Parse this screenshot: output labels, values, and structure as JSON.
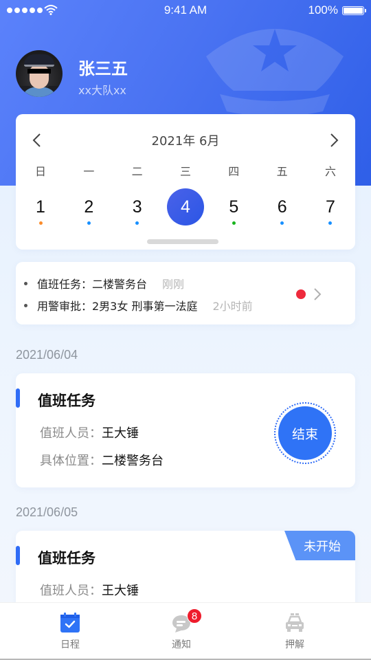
{
  "status_bar": {
    "time": "9:41 AM",
    "battery": "100%",
    "signal_icon": "signal-dots-icon",
    "wifi_icon": "wifi-icon",
    "battery_icon": "battery-icon"
  },
  "profile": {
    "name": "张三五",
    "unit": "xx大队xx",
    "avatar_icon": "police-avatar",
    "background_icon": "police-cap-icon"
  },
  "calendar": {
    "title": "2021年 6月",
    "weekdays": [
      "日",
      "一",
      "二",
      "三",
      "四",
      "五",
      "六"
    ],
    "days": [
      {
        "num": "1",
        "dot_color": "#fb8c2c",
        "active": false
      },
      {
        "num": "2",
        "dot_color": "#1890ff",
        "active": false
      },
      {
        "num": "3",
        "dot_color": "#1890ff",
        "active": false
      },
      {
        "num": "4",
        "dot_color": null,
        "active": true
      },
      {
        "num": "5",
        "dot_color": "#19b41e",
        "active": false
      },
      {
        "num": "6",
        "dot_color": "#1890ff",
        "active": false
      },
      {
        "num": "7",
        "dot_color": "#1890ff",
        "active": false
      }
    ]
  },
  "notices": [
    {
      "text": "值班任务：二楼警务台",
      "time": "刚刚"
    },
    {
      "text": "用警审批：2男3女 刑事第一法庭",
      "time": "2小时前"
    }
  ],
  "notice_unread_color": "#ee2a3c",
  "tasks": [
    {
      "date": "2021/06/04",
      "title": "值班任务",
      "rows": [
        {
          "label": "值班人员：",
          "value": "王大锤"
        },
        {
          "label": "具体位置：",
          "value": "二楼警务台"
        }
      ],
      "action": "结束"
    },
    {
      "date": "2021/06/05",
      "title": "值班任务",
      "status": "未开始",
      "rows": [
        {
          "label": "值班人员：",
          "value": "王大锤"
        }
      ]
    }
  ],
  "tabbar": {
    "items": [
      {
        "label": "日程",
        "icon": "calendar-check-icon",
        "active": true
      },
      {
        "label": "通知",
        "icon": "chat-bubble-icon",
        "badge": "8"
      },
      {
        "label": "押解",
        "icon": "police-car-icon"
      }
    ]
  },
  "colors": {
    "primary": "#2f6cf6",
    "hero_start": "#5b82fb",
    "hero_end": "#2f5fe8",
    "badge_red": "#ee1c2c",
    "status_tag": "#5b93f7"
  }
}
